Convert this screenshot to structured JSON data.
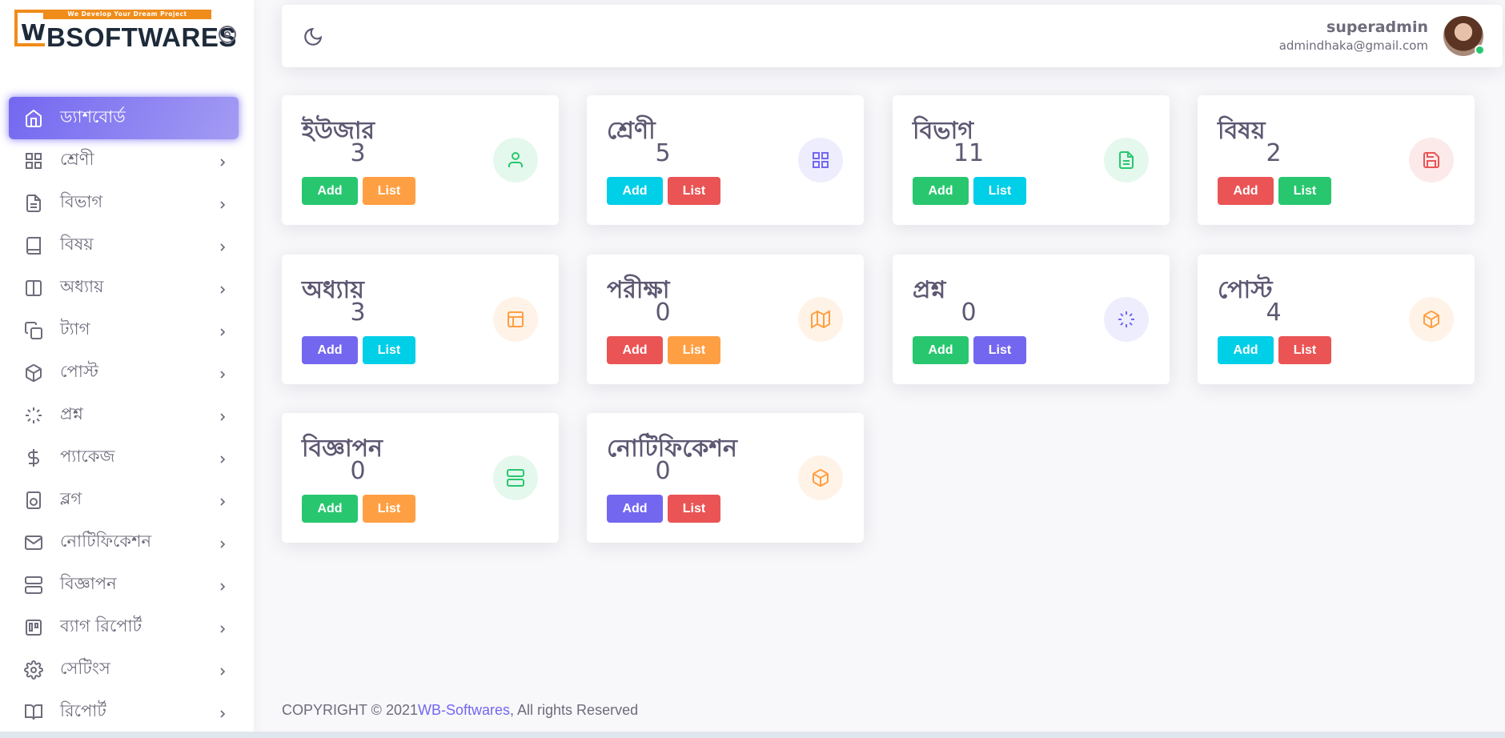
{
  "brand": {
    "tagline": "We Develop Your Dream Project",
    "mark": "W",
    "name": "BSOFTWARES"
  },
  "sidebar": {
    "items": [
      {
        "label": "ড্যাশবোর্ড",
        "icon": "home-icon",
        "active": true
      },
      {
        "label": "শ্রেণী",
        "icon": "grid-icon"
      },
      {
        "label": "বিভাগ",
        "icon": "file-text-icon"
      },
      {
        "label": "বিষয়",
        "icon": "book-icon"
      },
      {
        "label": "অধ্যায়",
        "icon": "columns-icon"
      },
      {
        "label": "ট্যাগ",
        "icon": "copy-icon"
      },
      {
        "label": "পোস্ট",
        "icon": "box-icon"
      },
      {
        "label": "প্রশ্ন",
        "icon": "loader-icon"
      },
      {
        "label": "প্যাকেজ",
        "icon": "dollar-icon"
      },
      {
        "label": "ব্লগ",
        "icon": "speaker-icon"
      },
      {
        "label": "নোটিফিকেশন",
        "icon": "mail-icon"
      },
      {
        "label": "বিজ্ঞাপন",
        "icon": "server-icon"
      },
      {
        "label": "ব্যাগ রিপোর্ট",
        "icon": "trello-icon"
      },
      {
        "label": "সেটিংস",
        "icon": "settings-icon"
      },
      {
        "label": "রিপোর্ট",
        "icon": "book-open-icon"
      }
    ]
  },
  "header": {
    "theme_icon": "moon-icon",
    "user_name": "superadmin",
    "user_email": "admindhaka@gmail.com"
  },
  "cards": [
    {
      "title": "ইউজার",
      "count": "3",
      "add": "Add",
      "list": "List",
      "icon": "user-icon"
    },
    {
      "title": "শ্রেণী",
      "count": "5",
      "add": "Add",
      "list": "List",
      "icon": "grid-icon"
    },
    {
      "title": "বিভাগ",
      "count": "11",
      "add": "Add",
      "list": "List",
      "icon": "file-text-icon"
    },
    {
      "title": "বিষয়",
      "count": "2",
      "add": "Add",
      "list": "List",
      "icon": "save-icon"
    },
    {
      "title": "অধ্যায়",
      "count": "3",
      "add": "Add",
      "list": "List",
      "icon": "layout-icon"
    },
    {
      "title": "পরীক্ষা",
      "count": "0",
      "add": "Add",
      "list": "List",
      "icon": "map-icon"
    },
    {
      "title": "প্রশ্ন",
      "count": "0",
      "add": "Add",
      "list": "List",
      "icon": "loader-icon"
    },
    {
      "title": "পোস্ট",
      "count": "4",
      "add": "Add",
      "list": "List",
      "icon": "box-icon"
    },
    {
      "title": "বিজ্ঞাপন",
      "count": "0",
      "add": "Add",
      "list": "List",
      "icon": "server-icon"
    },
    {
      "title": "নোটিফিকেশন",
      "count": "0",
      "add": "Add",
      "list": "List",
      "icon": "box-icon"
    }
  ],
  "colors": {
    "primary": "#7367f0",
    "success": "#28c76f",
    "info": "#00cfe8",
    "danger": "#ea5455",
    "warning": "#ff9f43"
  },
  "footer": {
    "prefix": "COPYRIGHT © 2021",
    "link": "WB-Softwares",
    "suffix": ", All rights Reserved"
  }
}
